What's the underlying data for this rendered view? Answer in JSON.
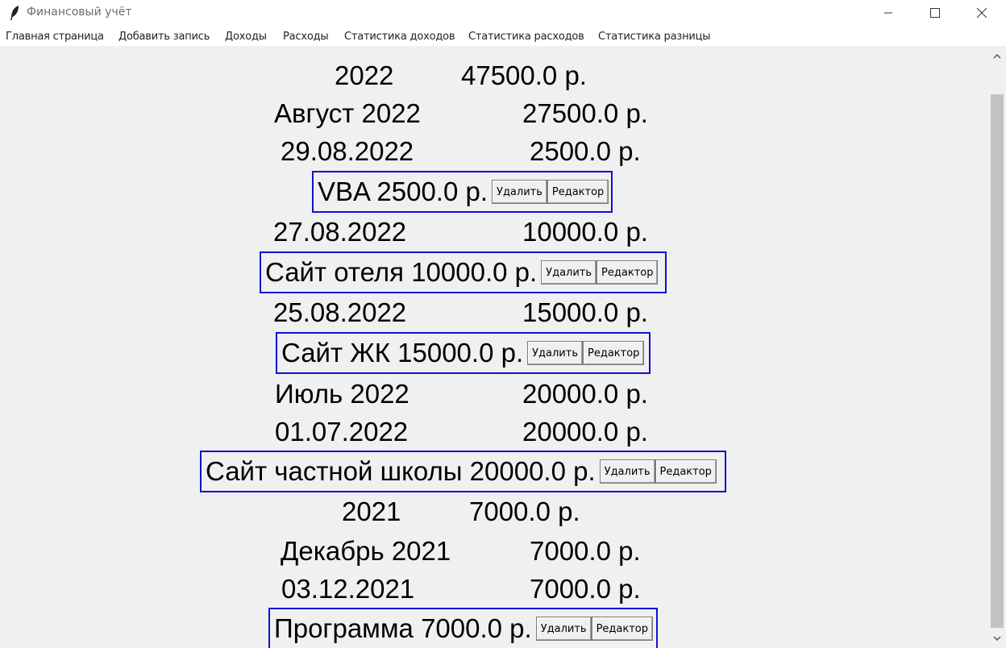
{
  "window": {
    "title": "Финансовый учёт"
  },
  "menu": [
    "Главная страница",
    "Добавить запись",
    "Доходы",
    "Расходы",
    "Статистика доходов",
    "Статистика расходов",
    "Статистика разницы"
  ],
  "buttons": {
    "delete": "Удалить",
    "edit": "Редактор"
  },
  "rows": {
    "y2022": {
      "label": "2022",
      "amount": "47500.0 р."
    },
    "aug2022": {
      "label": "Август 2022",
      "amount": "27500.0 р."
    },
    "d29082022": {
      "label": "29.08.2022",
      "amount": "2500.0 р."
    },
    "d27082022": {
      "label": "27.08.2022",
      "amount": "10000.0 р."
    },
    "d25082022": {
      "label": "25.08.2022",
      "amount": "15000.0 р."
    },
    "jul2022": {
      "label": "Июль 2022",
      "amount": "20000.0 р."
    },
    "d01072022": {
      "label": "01.07.2022",
      "amount": "20000.0 р."
    },
    "y2021": {
      "label": "2021",
      "amount": "7000.0 р."
    },
    "dec2021": {
      "label": "Декабрь 2021",
      "amount": "7000.0 р."
    },
    "d03122021": {
      "label": "03.12.2021",
      "amount": "7000.0 р."
    }
  },
  "entries": {
    "vba": "VBA 2500.0 р.",
    "hotel": "Сайт отеля 10000.0 р.",
    "zhk": "Сайт ЖК 15000.0 р.",
    "school": "Сайт частной школы 20000.0 р.",
    "program": "Программа 7000.0 р."
  }
}
